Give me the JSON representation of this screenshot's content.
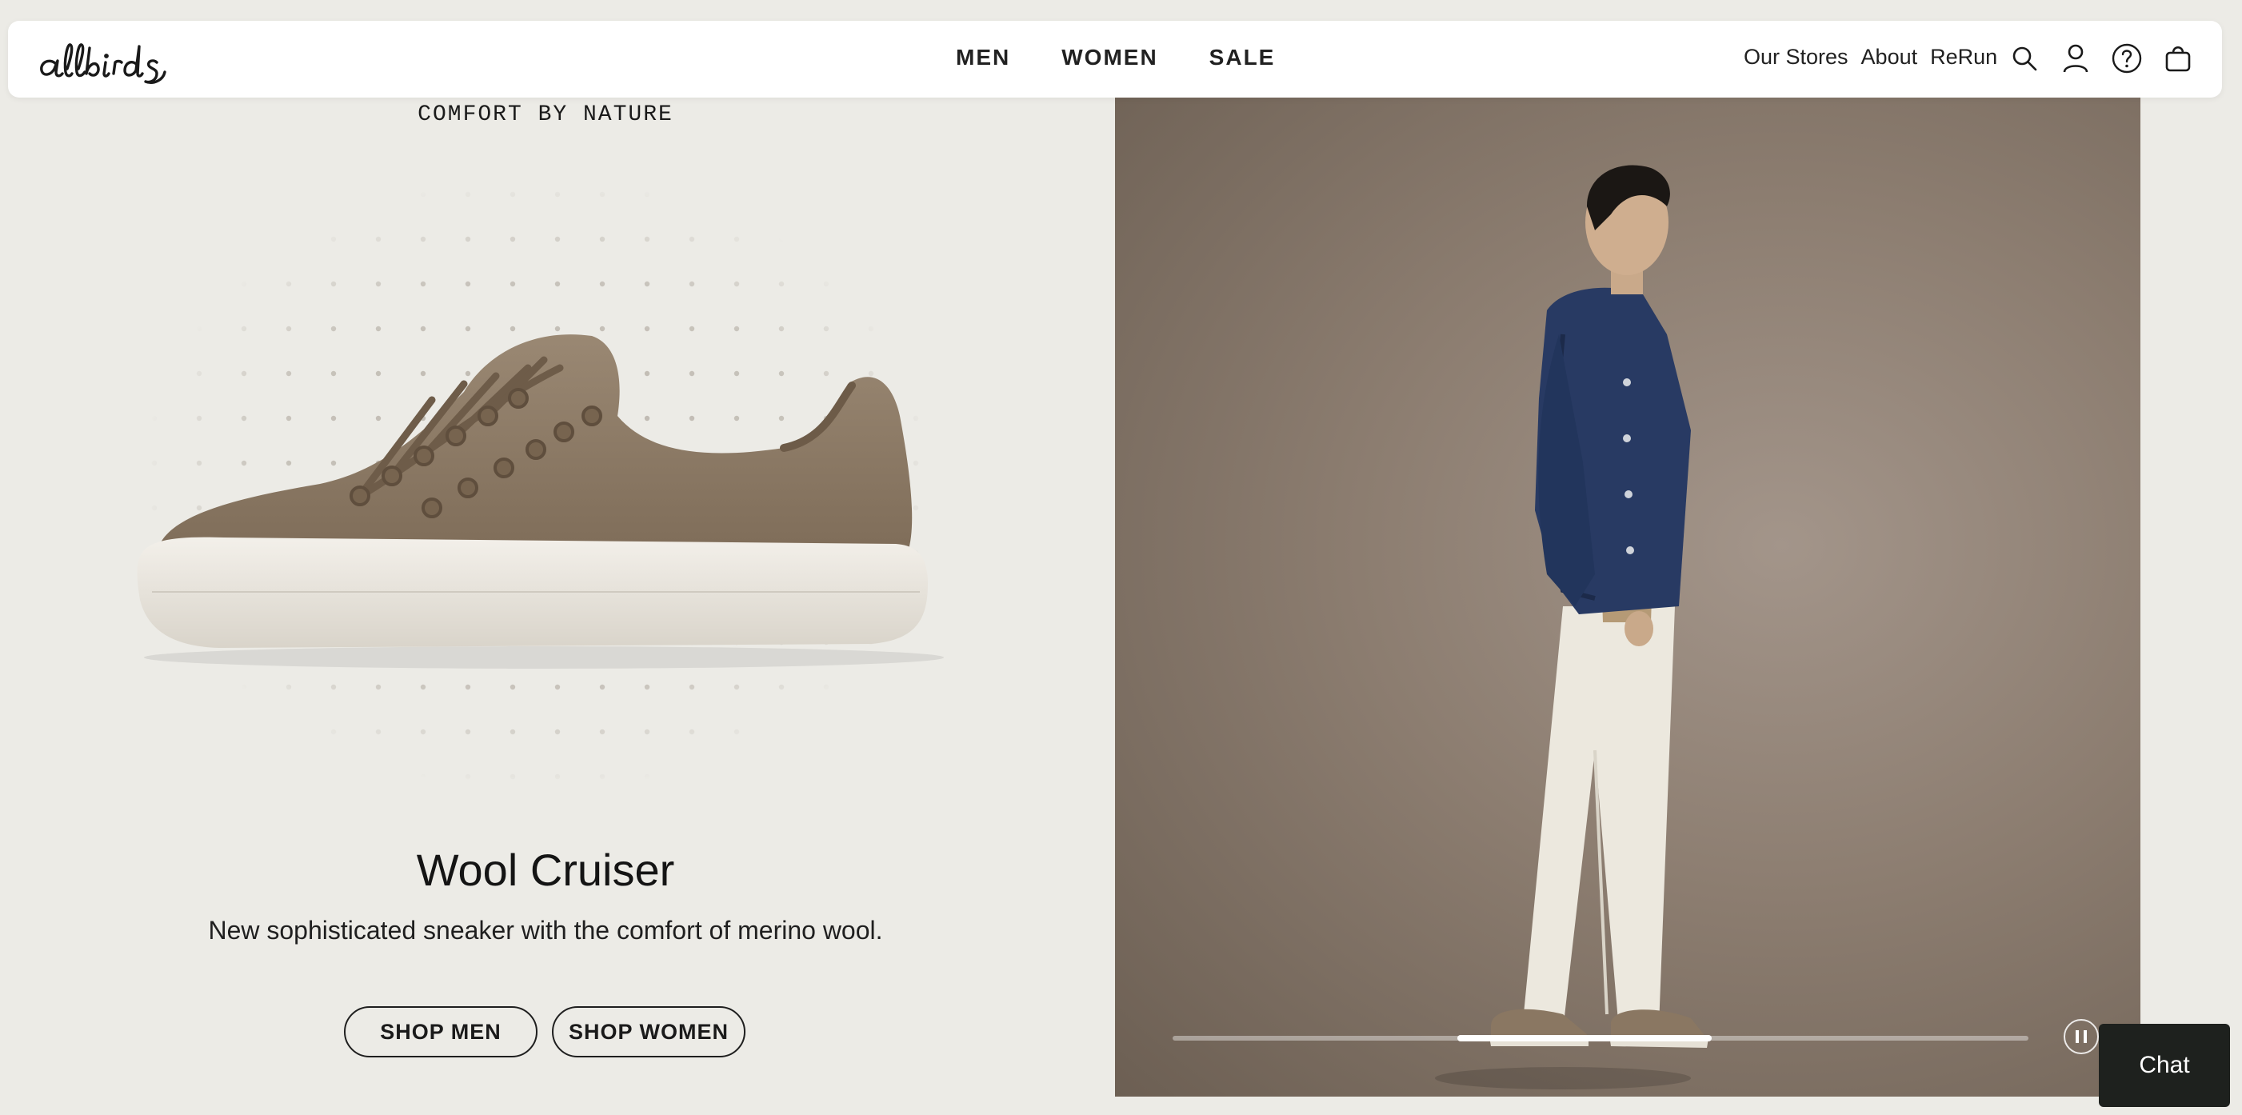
{
  "brand": {
    "logo_text": "allbirds"
  },
  "nav": {
    "main": [
      {
        "label": "MEN"
      },
      {
        "label": "WOMEN"
      },
      {
        "label": "SALE"
      }
    ],
    "utility": [
      {
        "label": "Our Stores"
      },
      {
        "label": "About"
      },
      {
        "label": "ReRun"
      }
    ],
    "icons": [
      "search-icon",
      "account-icon",
      "help-icon",
      "cart-icon"
    ]
  },
  "hero": {
    "eyebrow": "COMFORT BY NATURE",
    "product_title": "Wool Cruiser",
    "product_subtitle": "New sophisticated sneaker with the comfort of merino wool.",
    "buttons": {
      "shop_men": "SHOP MEN",
      "shop_women": "SHOP WOMEN"
    },
    "carousel": {
      "progress_fraction": 0.3,
      "state": "playing"
    }
  },
  "chat": {
    "label": "Chat"
  },
  "colors": {
    "page_background": "#ecebe6",
    "header_background": "#ffffff",
    "chat_background": "#1e211e",
    "photo_background": "#8c7d70",
    "shoe_felt": "#8f7d66",
    "shoe_sole": "#e9e5dc"
  }
}
